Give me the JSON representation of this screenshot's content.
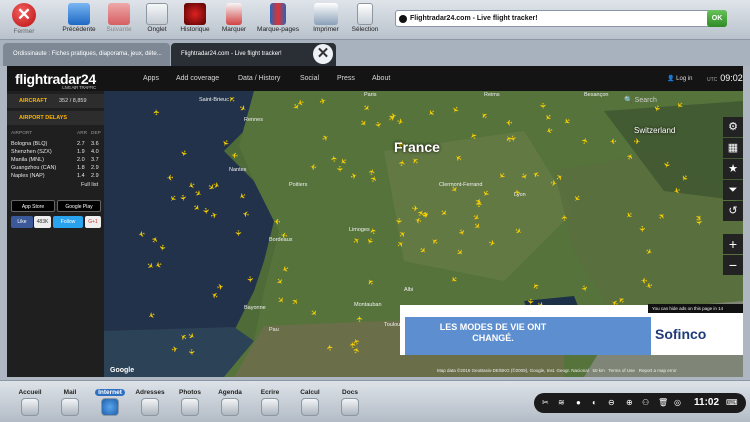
{
  "toolbar": {
    "close": "Fermer",
    "buttons": [
      "Précédente",
      "Suivante",
      "Onglet",
      "Historique",
      "Marquer",
      "Marque-pages",
      "Imprimer",
      "Sélection"
    ],
    "url_text": "Flightradar24.com - Live flight tracker!",
    "ok": "OK"
  },
  "tabs": [
    "Ordissinaute : Fiches pratiques, diaporama, jeux, déte...",
    "Flightradar24.com - Live flight tracker!"
  ],
  "site": {
    "logo": "flightradar24",
    "logo_sub": "LIVE AIR TRAFFIC",
    "nav": [
      "Apps",
      "Add coverage",
      "Data / History",
      "Social",
      "Press",
      "About"
    ],
    "login": "Log in",
    "utc_label": "UTC",
    "time": "09:02",
    "aircraft_label": "AIRCRAFT",
    "aircraft_count": "352 / 8,859",
    "delays_label": "AIRPORT DELAYS",
    "delay_headers": {
      "airport": "AIRPORT",
      "arr": "ARR",
      "dep": "DEP"
    },
    "delays": [
      {
        "airport": "Bologna (BLQ)",
        "arr": "2.7",
        "dep": "3.6"
      },
      {
        "airport": "Shenzhen (SZX)",
        "arr": "1.9",
        "dep": "4.0"
      },
      {
        "airport": "Manila (MNL)",
        "arr": "2.0",
        "dep": "3.7"
      },
      {
        "airport": "Guangzhou (CAN)",
        "arr": "1.8",
        "dep": "2.9"
      },
      {
        "airport": "Naples (NAP)",
        "arr": "1.4",
        "dep": "2.9"
      }
    ],
    "full_list": "Full list",
    "appstore": "App Store",
    "googleplay": "Google Play",
    "fb_like": "Like",
    "fb_count": "483K",
    "tw_follow": "Follow",
    "gplus": "G+1",
    "map": {
      "country_label": "France",
      "switzerland": "Switzerland",
      "search_label": "Search",
      "attribution": "Map data ©2016 GeoBasis-DE/BKG (©2009), Google, Inst. Geogr. Nacional",
      "scale": "50 km",
      "terms": "Terms of Use",
      "report": "Report a map error",
      "google": "Google",
      "cities": [
        "Saint-Brieuc",
        "Rennes",
        "Nantes",
        "Poitiers",
        "Limoges",
        "Clermont-Ferrand",
        "Lyon",
        "Bordeaux",
        "Toulouse",
        "Montauban",
        "Albi",
        "Paris",
        "Reims",
        "Besançon",
        "Bayonne",
        "Pau"
      ]
    },
    "ad_note": "You can hide ads on this page in 14",
    "ad_text": "LES MODES DE VIE ONT CHANGÉ.",
    "ad_brand": "Sofinco"
  },
  "taskbar": {
    "apps": [
      "Accueil",
      "Mail",
      "Internet",
      "Adresses",
      "Photos",
      "Agenda",
      "Ecrire",
      "Calcul",
      "Docs"
    ],
    "active": "Internet",
    "clock": "11:02"
  }
}
